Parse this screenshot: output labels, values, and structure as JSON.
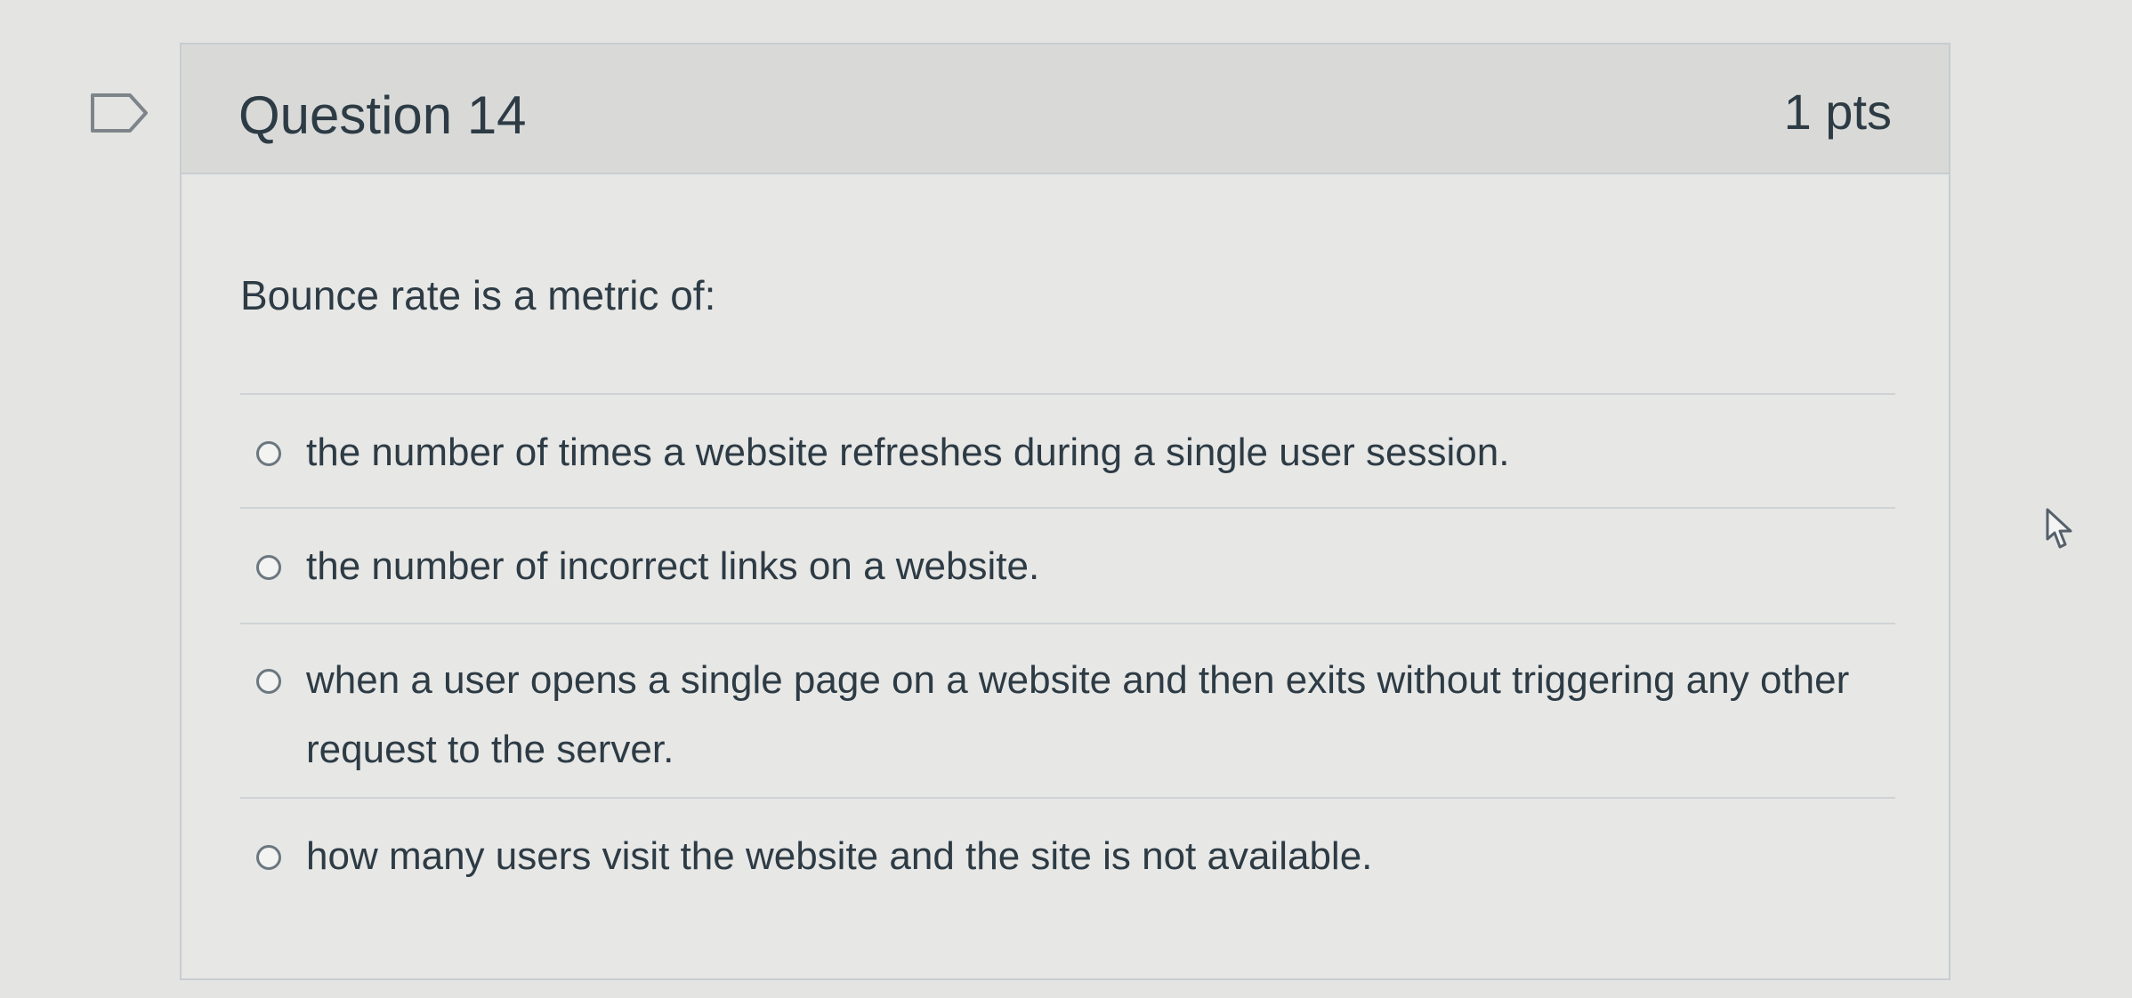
{
  "question": {
    "title": "Question 14",
    "points": "1 pts",
    "text": "Bounce rate is a metric of:"
  },
  "answers": [
    {
      "label": "the number of times a website refreshes during a single user session."
    },
    {
      "label": "the number of incorrect links on a website."
    },
    {
      "label": "when a user opens a single page on a website and then exits without triggering any other request to the server."
    },
    {
      "label": "how many users visit the website and the site is not available."
    }
  ],
  "icons": {
    "flag": "flag-question-icon",
    "cursor": "mouse-pointer-icon",
    "radio": "radio-unselected-icon"
  },
  "colors": {
    "text": "#2d3b45",
    "header_bg": "#d9dad8",
    "border": "#c7cdd1",
    "radio_border": "#6b7780"
  }
}
